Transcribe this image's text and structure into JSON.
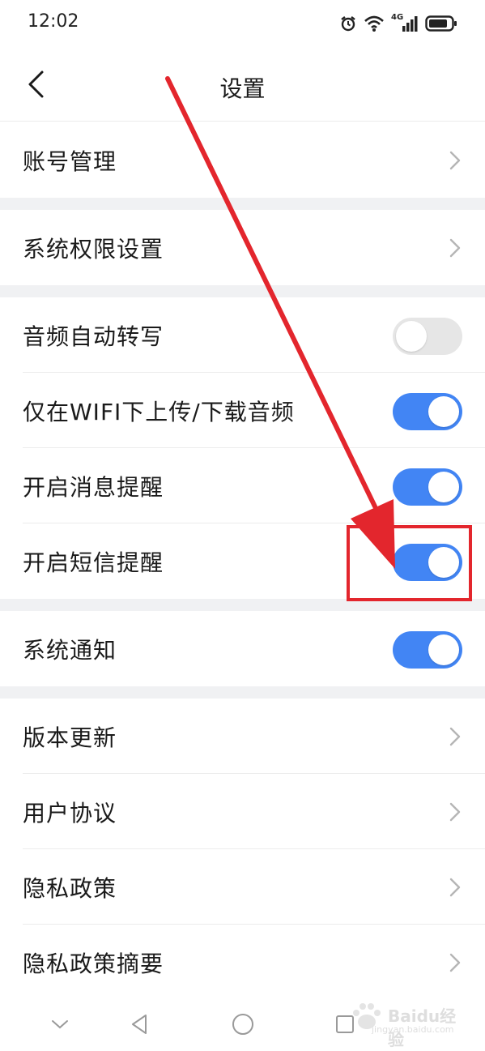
{
  "status_bar": {
    "time": "12:02",
    "network": "4G",
    "icons": [
      "alarm-icon",
      "wifi-icon",
      "signal-icon",
      "battery-icon"
    ]
  },
  "header": {
    "title": "设置",
    "back_icon": "back-arrow-icon"
  },
  "rows": [
    {
      "label": "账号管理",
      "type": "chevron"
    },
    {
      "label": "系统权限设置",
      "type": "chevron"
    },
    {
      "label": "音频自动转写",
      "type": "toggle",
      "on": false
    },
    {
      "label": "仅在WIFI下上传/下载音频",
      "type": "toggle",
      "on": true
    },
    {
      "label": "开启消息提醒",
      "type": "toggle",
      "on": true
    },
    {
      "label": "开启短信提醒",
      "type": "toggle",
      "on": true
    },
    {
      "label": "系统通知",
      "type": "toggle",
      "on": true
    },
    {
      "label": "版本更新",
      "type": "chevron"
    },
    {
      "label": "用户协议",
      "type": "chevron"
    },
    {
      "label": "隐私政策",
      "type": "chevron"
    },
    {
      "label": "隐私政策摘要",
      "type": "chevron"
    }
  ],
  "nav_bar": {
    "buttons": [
      "collapse-icon",
      "back-triangle-icon",
      "home-circle-icon",
      "recents-square-icon"
    ]
  },
  "watermark": {
    "logo_text": "Baidu经验",
    "url": "jingyan.baidu.com"
  },
  "colors": {
    "toggle_on": "#4285f4",
    "toggle_off": "#e6e6e6",
    "section_gap": "#f0f1f3",
    "annotation": "#e3262d"
  }
}
